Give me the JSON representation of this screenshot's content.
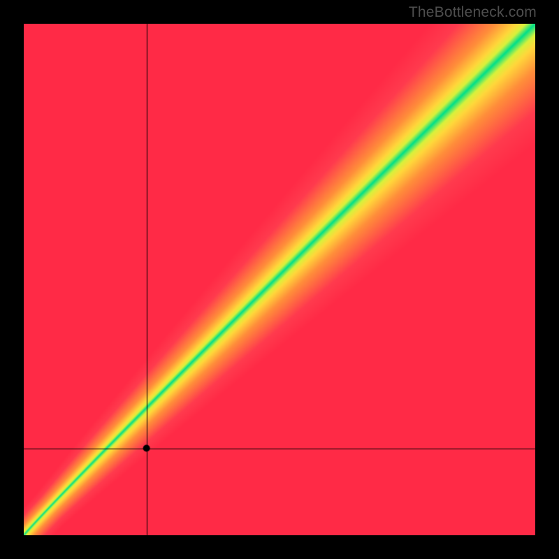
{
  "watermark": "TheBottleneck.com",
  "chart_data": {
    "type": "heatmap",
    "title": "",
    "xlabel": "",
    "ylabel": "",
    "xlim": [
      0,
      100
    ],
    "ylim": [
      0,
      100
    ],
    "crosshair": {
      "x": 24,
      "y": 17
    },
    "marker": {
      "x": 24,
      "y": 17
    },
    "optimal_band": {
      "description": "Diagonal green band where y ≈ x (slight nonlinearity near origin)",
      "slope": 1.0,
      "width_fraction": 0.09
    },
    "color_scale": [
      {
        "distance": 0.0,
        "color": "#00e08a"
      },
      {
        "distance": 0.08,
        "color": "#d8f23c"
      },
      {
        "distance": 0.16,
        "color": "#ffd83b"
      },
      {
        "distance": 0.35,
        "color": "#ff8f3a"
      },
      {
        "distance": 0.7,
        "color": "#ff3b4e"
      },
      {
        "distance": 1.0,
        "color": "#ff2a46"
      }
    ],
    "grid": false,
    "legend": false
  }
}
